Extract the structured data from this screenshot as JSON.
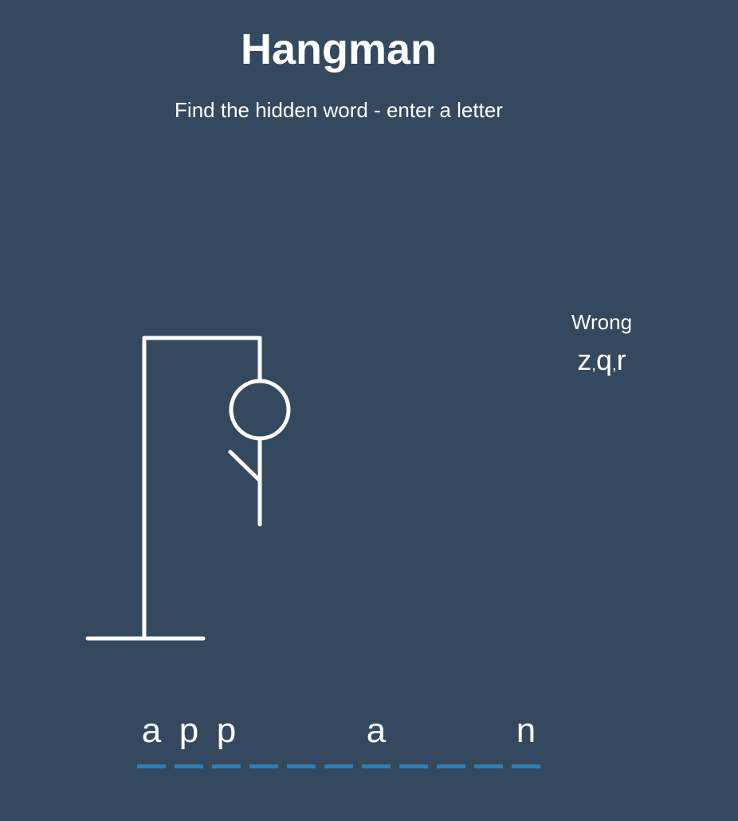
{
  "header": {
    "title": "Hangman",
    "subtitle": "Find the hidden word - enter a letter"
  },
  "wrong": {
    "heading": "Wrong",
    "letters": [
      "z",
      "q",
      "r"
    ]
  },
  "word": {
    "letters": [
      "a",
      "p",
      "p",
      "",
      "",
      "",
      "a",
      "",
      "",
      "",
      "n"
    ]
  },
  "figure": {
    "parts_shown": [
      "gallows-base",
      "gallows-pole",
      "gallows-beam",
      "rope",
      "head",
      "body",
      "left-arm"
    ],
    "color": "#ffffff"
  },
  "colors": {
    "background": "#34495e",
    "text": "#ffffff",
    "underline": "#2980b9"
  }
}
